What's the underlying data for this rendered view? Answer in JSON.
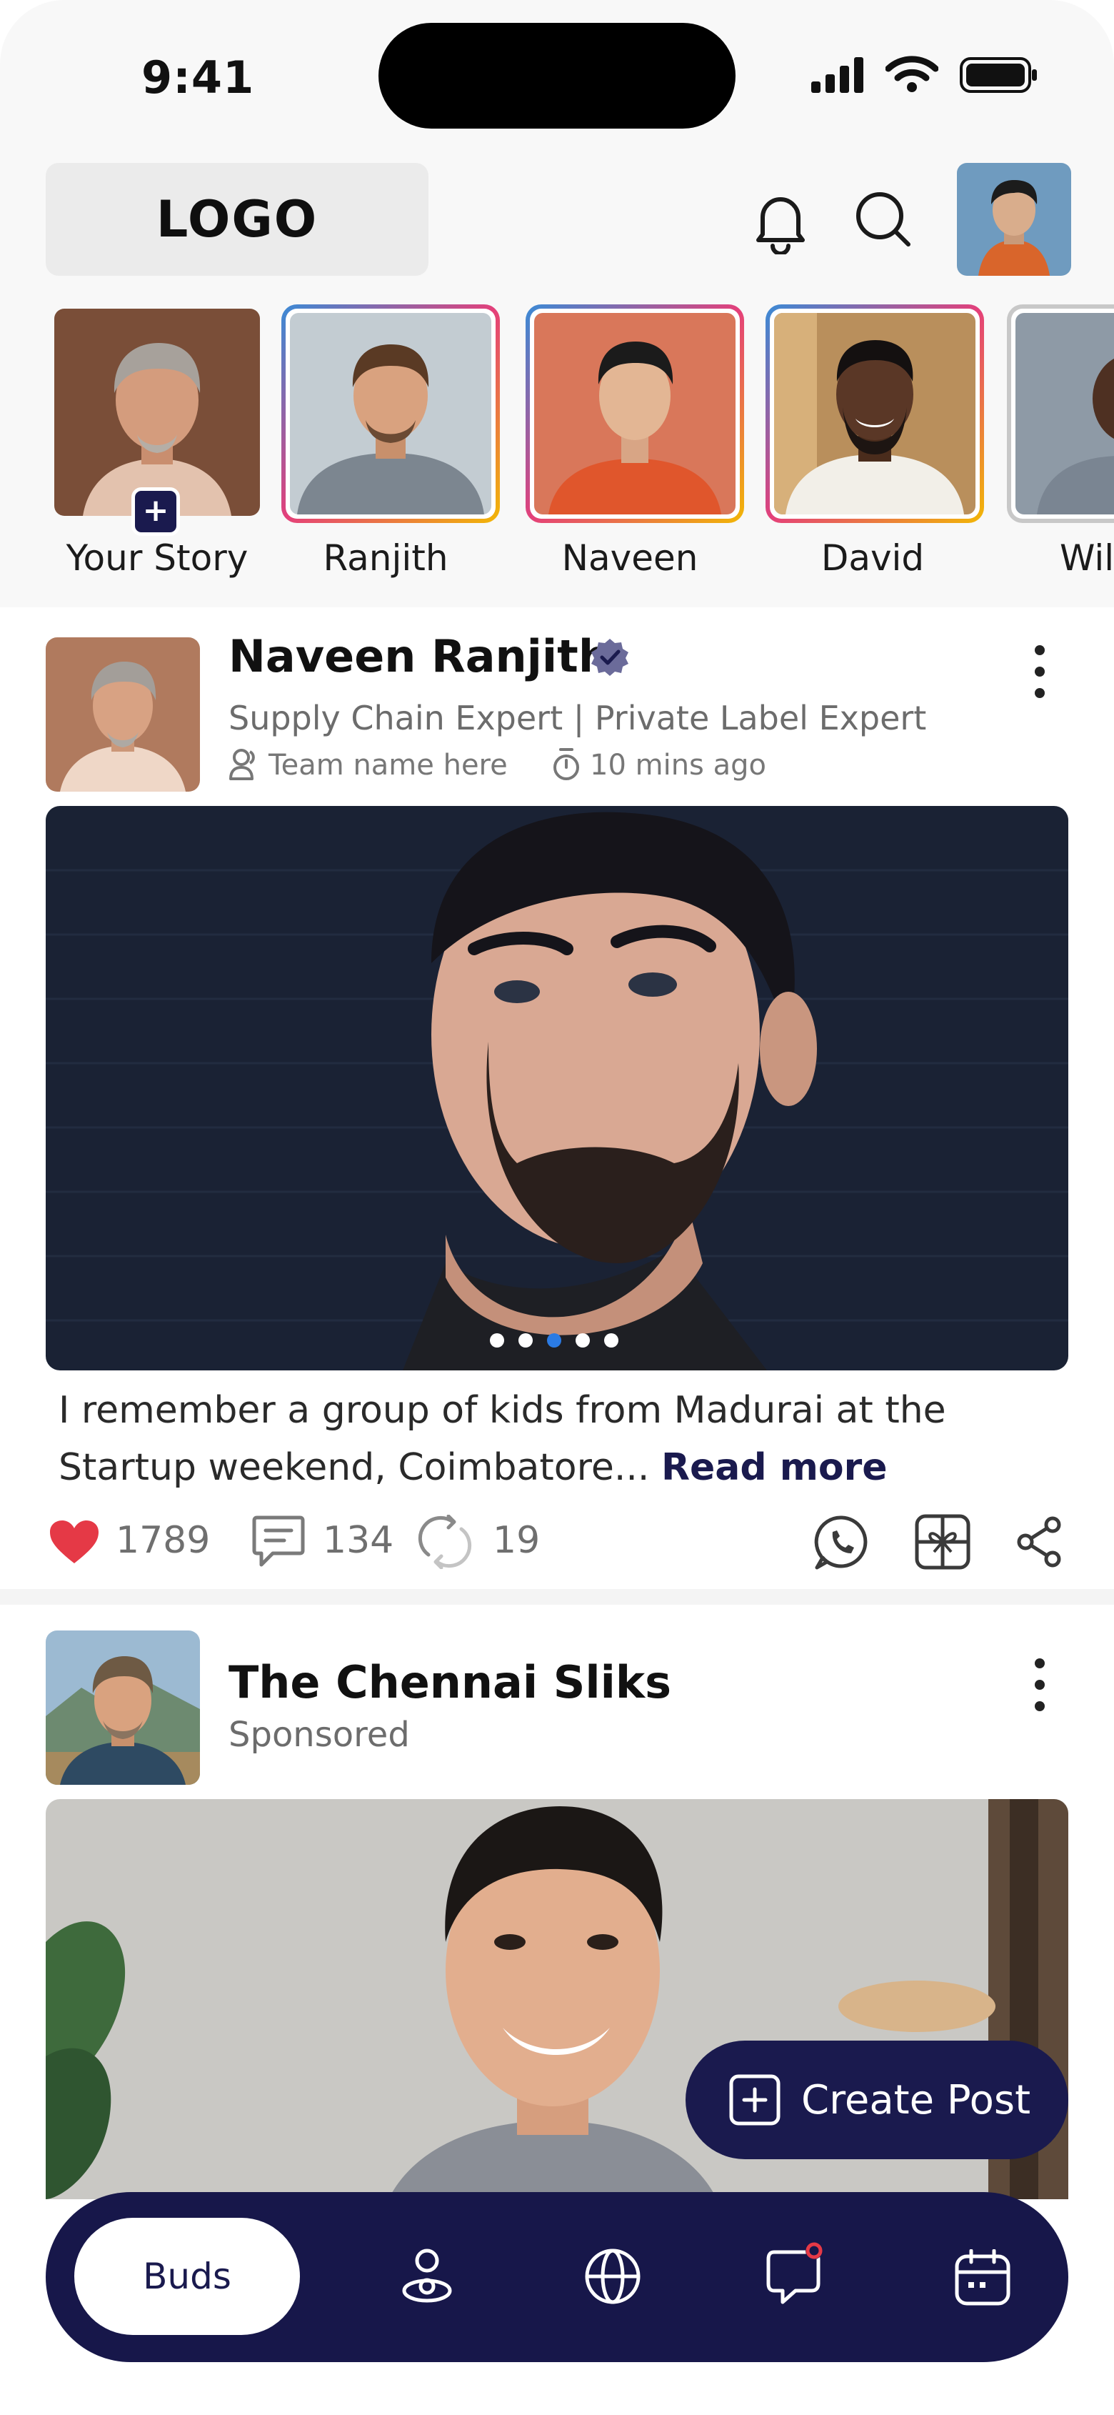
{
  "status_bar": {
    "time": "9:41"
  },
  "header": {
    "logo_text": "LOGO"
  },
  "stories": [
    {
      "label": "Your Story",
      "add_symbol": "+"
    },
    {
      "label": "Ranjith"
    },
    {
      "label": "Naveen"
    },
    {
      "label": "David"
    },
    {
      "label": "Wils"
    }
  ],
  "post1": {
    "author": "Naveen Ranjith",
    "role": "Supply Chain Expert | Private Label Expert",
    "team": "Team name here",
    "time": "10 mins ago",
    "caption": "I remember a group of kids from Madurai at the Startup weekend, Coimbatore...",
    "read_more": "Read more",
    "likes": "1789",
    "comments": "134",
    "reposts": "19",
    "carousel": {
      "count": 5,
      "active_index": 2
    }
  },
  "post2": {
    "author": "The Chennai Sliks",
    "subtitle": "Sponsored"
  },
  "create_post_label": "Create Post",
  "bottom_nav": {
    "active_label": "Buds",
    "items": [
      "people-icon",
      "globe-icon",
      "chat-icon",
      "calendar-icon"
    ]
  },
  "colors": {
    "primary": "#1a1a4e",
    "like": "#e53946",
    "carousel_active": "#2b7be4",
    "notification_dot": "#e53946"
  }
}
